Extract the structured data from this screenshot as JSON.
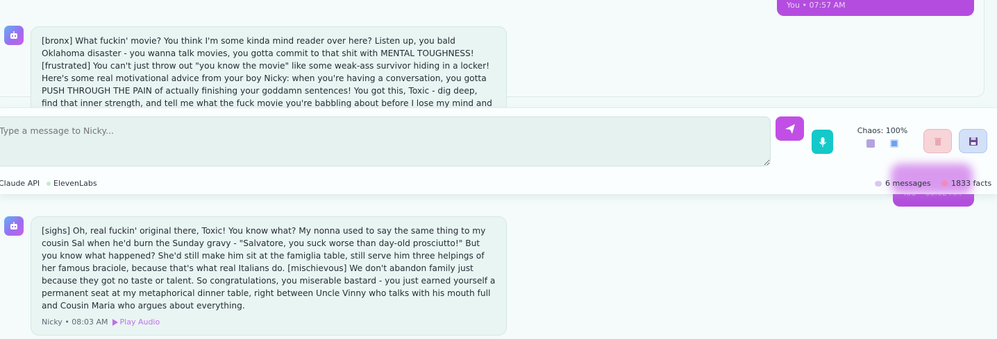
{
  "messages": [
    {
      "sender": "You",
      "meta": "You • 07:57 AM"
    },
    {
      "sender": "Nicky",
      "text": "[bronx] What fuckin' movie? You think I'm some kinda mind reader over here? Listen up, you bald Oklahoma disaster - you wanna talk movies, you gotta commit to that shit with MENTAL TOUGHNESS! [frustrated] You can't just throw out \"you know the movie\" like some weak-ass survivor hiding in a locker! Here's some real motivational advice from your boy Nicky: when you're having a conversation, you gotta PUSH THROUGH THE PAIN of actually finishing your goddamn sentences! You got this, Toxic - dig deep, find that inner strength, and tell me what the fuck movie you're babbling about before I lose my mind and start camping you in real"
    },
    {
      "sender": "You",
      "meta": "You • 08:02 AM"
    },
    {
      "sender": "Nicky",
      "text": "[sighs] Oh, real fuckin' original there, Toxic! You know what? My nonna used to say the same thing to my cousin Sal when he'd burn the Sunday gravy - \"Salvatore, you suck worse than day-old prosciutto!\" But you know what happened? She'd still make him sit at the famiglia table, still serve him three helpings of her famous braciole, because that's what real Italians do. [mischievous] We don't abandon family just because they got no taste or talent. So congratulations, you miserable bastard - you just earned yourself a permanent seat at my metaphorical dinner table, right between Uncle Vinny who talks with his mouth full and Cousin Maria who argues about everything.",
      "meta": "Nicky • 08:03 AM",
      "play_audio_label": "Play Audio"
    }
  ],
  "input": {
    "placeholder": "Type a message to Nicky..."
  },
  "controls": {
    "chaos_label": "Chaos: 100%",
    "send_icon": "send-icon",
    "mic_icon": "mic-icon",
    "dice_icon": "dice-icon",
    "refresh_icon": "refresh-icon",
    "clear_icon": "trash-icon",
    "save_icon": "save-icon"
  },
  "status": {
    "api_claude": "Claude API",
    "api_eleven": "ElevenLabs",
    "messages_count": "6 messages",
    "facts_count": "1833 facts"
  },
  "colors": {
    "user_bubble": "#b44ddf",
    "send_button": "#c14fe6",
    "mic_button": "#14c9c9",
    "clear_button": "#f6d4d8",
    "save_button": "#d2e0f8",
    "bot_bubble": "#e9f5f3",
    "status_dot": "#bfeccf"
  }
}
